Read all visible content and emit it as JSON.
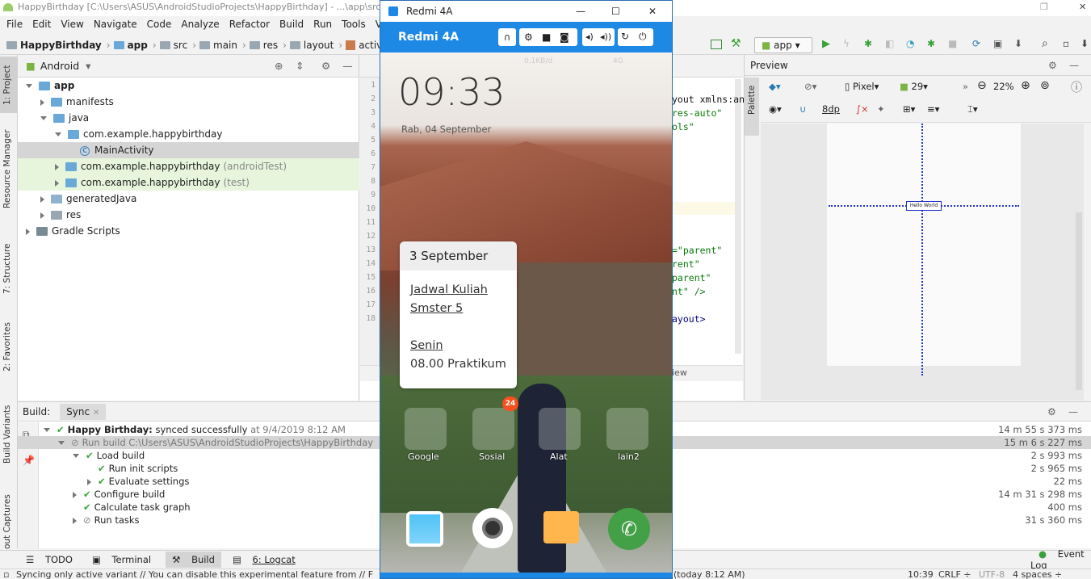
{
  "window": {
    "title": "HappyBirthday [C:\\Users\\ASUS\\AndroidStudioProjects\\HappyBirthday] - ...\\app\\src\\"
  },
  "menu": [
    "File",
    "Edit",
    "View",
    "Navigate",
    "Code",
    "Analyze",
    "Refactor",
    "Build",
    "Run",
    "Tools",
    "VCS",
    "W"
  ],
  "breadcrumb": [
    "HappyBirthday",
    "app",
    "src",
    "main",
    "res",
    "layout",
    "activity_ma"
  ],
  "run_config": "app",
  "side_tabs": {
    "project": "1: Project",
    "resource": "Resource Manager",
    "structure": "7: Structure",
    "favorites": "2: Favorites",
    "build_variants": "Build Variants",
    "captures": "out Captures"
  },
  "project": {
    "view": "Android",
    "rows": [
      {
        "label": "app",
        "bold": true
      },
      {
        "label": "manifests"
      },
      {
        "label": "java"
      },
      {
        "label": "com.example.happybirthday"
      },
      {
        "label": "MainActivity"
      },
      {
        "label": "com.example.happybirthday",
        "suffix": "(androidTest)"
      },
      {
        "label": "com.example.happybirthday",
        "suffix": "(test)"
      },
      {
        "label": "generatedJava"
      },
      {
        "label": "res"
      },
      {
        "label": "Gradle Scripts"
      }
    ]
  },
  "editor": {
    "line_numbers": [
      "1",
      "2",
      "3",
      "4",
      "5",
      "6",
      "7",
      "8",
      "9",
      "10",
      "11",
      "12",
      "13",
      "14",
      "15",
      "16",
      "17",
      "18"
    ],
    "code_fragments": [
      "yout xmlns:an",
      "res-auto\"",
      "ols\"",
      "=\"parent\"",
      "rent\"",
      "parent\"",
      "nt\" />",
      "ayout>"
    ],
    "bottom_tab": "iew"
  },
  "preview": {
    "title": "Preview",
    "palette": "Palette",
    "device": "Pixel",
    "api": "29",
    "zoom": "22%",
    "margin": "8dp",
    "widget_text": "Hello World"
  },
  "build": {
    "tabs": [
      "Build:",
      "Sync"
    ],
    "rows": [
      {
        "bold": "Happy Birthday:",
        "text": " synced successfully",
        "time": " at 9/4/2019 8:12 AM",
        "duration": "14 m 55 s 373 ms"
      },
      {
        "text": "Run build C:\\Users\\ASUS\\AndroidStudioProjects\\HappyBirthday",
        "duration": "15 m 6 s 227 ms"
      },
      {
        "text": "Load build",
        "duration": "2 s 993 ms"
      },
      {
        "text": "Run init scripts",
        "duration": "2 s 965 ms"
      },
      {
        "text": "Evaluate settings",
        "duration": "22 ms"
      },
      {
        "text": "Configure build",
        "duration": "14 m 31 s 298 ms"
      },
      {
        "text": "Calculate task graph",
        "duration": "400 ms"
      },
      {
        "text": "Run tasks",
        "duration": "31 s 360 ms"
      }
    ]
  },
  "bottom_tools": {
    "todo": "TODO",
    "terminal": "Terminal",
    "build": "Build",
    "logcat": "6: Logcat",
    "event_log": "Event Log"
  },
  "status": {
    "message": "Syncing only active variant // You can disable this experimental feature from // F",
    "time": "(today 8:12 AM)",
    "position": "10:39",
    "line_ending": "CRLF",
    "encoding": "UTF-8",
    "indent": "4 spaces"
  },
  "phone": {
    "window_title": "Redmi 4A",
    "device_label": "Redmi 4A",
    "clock": "09:33",
    "date": "Rab, 04 September",
    "status_left": "0,1KB/d",
    "status_right": "4G",
    "card_title": "3 September",
    "card_lines": [
      "Jadwal Kuliah",
      "Smster 5",
      "Senin",
      "08.00 Praktikum"
    ],
    "badge": "24",
    "apps": [
      "Google",
      "Sosial",
      "Alat",
      "lain2"
    ]
  },
  "colors": {
    "accent": "#1e88e5",
    "green": "#3aa13a"
  }
}
